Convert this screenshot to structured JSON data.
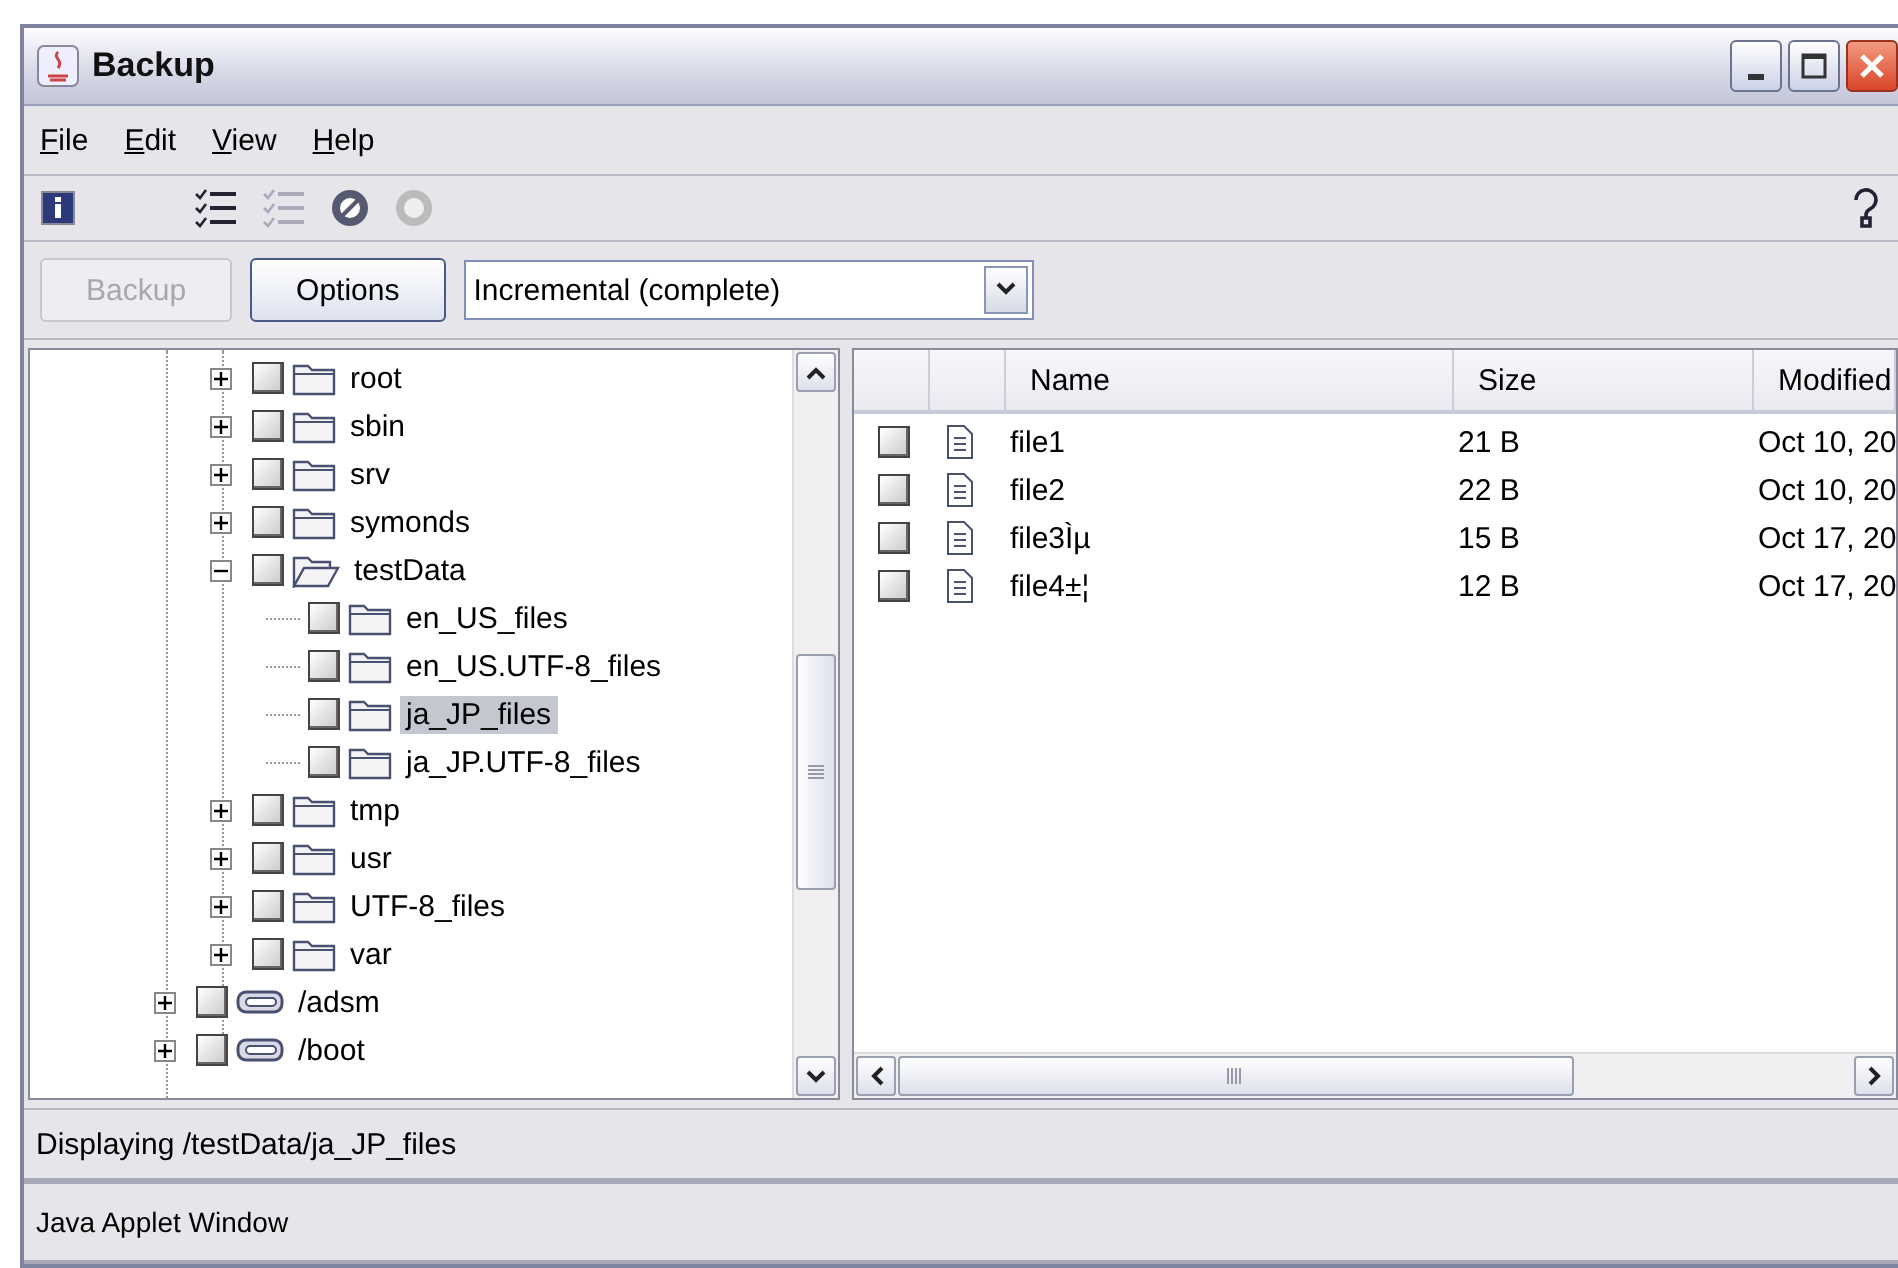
{
  "window": {
    "title": "Backup"
  },
  "menu": [
    {
      "mnemonic": "F",
      "rest": "ile"
    },
    {
      "mnemonic": "E",
      "rest": "dit"
    },
    {
      "mnemonic": "V",
      "rest": "iew"
    },
    {
      "mnemonic": "H",
      "rest": "elp"
    }
  ],
  "toolbar": [
    {
      "kind": "info",
      "disabled": false
    },
    {
      "kind": "gap"
    },
    {
      "kind": "check-list",
      "disabled": false
    },
    {
      "kind": "clear-list",
      "disabled": true
    },
    {
      "kind": "cancel",
      "disabled": false
    },
    {
      "kind": "stop",
      "disabled": true
    },
    {
      "kind": "help",
      "disabled": false
    }
  ],
  "actions": {
    "buttons": [
      {
        "label": "Backup",
        "disabled": true
      },
      {
        "label": "Options",
        "disabled": false
      }
    ],
    "mode": {
      "value": "Incremental (complete)"
    }
  },
  "tree": {
    "nodes": [
      {
        "children": [
          {
            "label": "root",
            "kind": "folder",
            "expanded": false,
            "checked": false,
            "selected": false
          },
          {
            "label": "sbin",
            "kind": "folder",
            "expanded": false,
            "checked": false,
            "selected": false
          },
          {
            "label": "srv",
            "kind": "folder",
            "expanded": false,
            "checked": false,
            "selected": false
          },
          {
            "label": "symonds",
            "kind": "folder",
            "expanded": false,
            "checked": false,
            "selected": false
          },
          {
            "label": "testData",
            "kind": "folder",
            "expanded": true,
            "checked": false,
            "selected": false,
            "children": [
              {
                "label": "en_US_files",
                "kind": "folder",
                "checked": false,
                "selected": false
              },
              {
                "label": "en_US.UTF-8_files",
                "kind": "folder",
                "checked": false,
                "selected": false
              },
              {
                "label": "ja_JP_files",
                "kind": "folder",
                "checked": false,
                "selected": true
              },
              {
                "label": "ja_JP.UTF-8_files",
                "kind": "folder",
                "checked": false,
                "selected": false
              }
            ]
          },
          {
            "label": "tmp",
            "kind": "folder",
            "expanded": false,
            "checked": false,
            "selected": false
          },
          {
            "label": "usr",
            "kind": "folder",
            "expanded": false,
            "checked": false,
            "selected": false
          },
          {
            "label": "UTF-8_files",
            "kind": "folder",
            "expanded": false,
            "checked": false,
            "selected": false
          },
          {
            "label": "var",
            "kind": "folder",
            "expanded": false,
            "checked": false,
            "selected": false
          }
        ]
      },
      {
        "label": "/adsm",
        "kind": "drive",
        "expanded": false,
        "checked": false,
        "selected": false
      },
      {
        "label": "/boot",
        "kind": "drive",
        "expanded": false,
        "checked": false,
        "selected": false
      }
    ]
  },
  "files": {
    "columns": [
      "Name",
      "Size",
      "Modified"
    ],
    "rows": [
      {
        "name": "file1",
        "size": "21 B",
        "modified": "Oct 10, 20",
        "checked": false
      },
      {
        "name": "file2",
        "size": "22 B",
        "modified": "Oct 10, 20",
        "checked": false
      },
      {
        "name": "file3Ìµ",
        "size": "15 B",
        "modified": "Oct 17, 20",
        "checked": false
      },
      {
        "name": "file4±¦",
        "size": "12 B",
        "modified": "Oct 17, 20",
        "checked": false
      }
    ]
  },
  "status_bar": "Displaying /testData/ja_JP_files",
  "applet_bar": "Java Applet Window"
}
